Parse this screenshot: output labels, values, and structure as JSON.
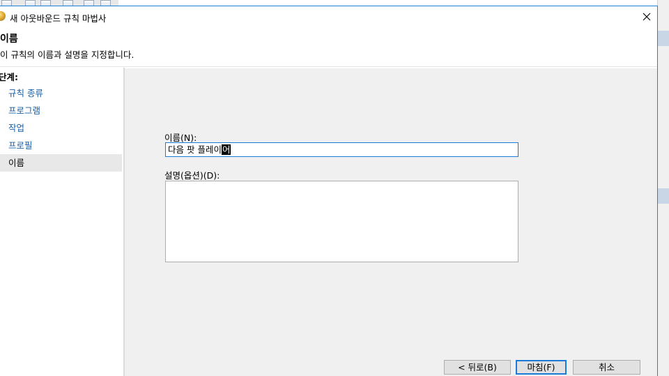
{
  "window": {
    "title": "새 아웃바운드 규칙 마법사",
    "close_icon": "close-icon"
  },
  "header": {
    "title": "이름",
    "subtitle": "이 규칙의 이름과 설명을 지정합니다."
  },
  "steps": {
    "title": "단계:",
    "items": [
      {
        "label": "규칙 종류",
        "active": false
      },
      {
        "label": "프로그램",
        "active": false
      },
      {
        "label": "작업",
        "active": false
      },
      {
        "label": "프로필",
        "active": false
      },
      {
        "label": "이름",
        "active": true
      }
    ]
  },
  "form": {
    "name_label": "이름(N):",
    "name_value": "다음 팟 플레이",
    "name_composing": "어",
    "description_label": "설명(옵션)(D):",
    "description_value": ""
  },
  "buttons": {
    "back": "< 뒤로(B)",
    "finish": "마침(F)",
    "cancel": "취소"
  },
  "colors": {
    "accent": "#1883d7",
    "link": "#1a5fa4",
    "panel": "#f0f0f0"
  }
}
